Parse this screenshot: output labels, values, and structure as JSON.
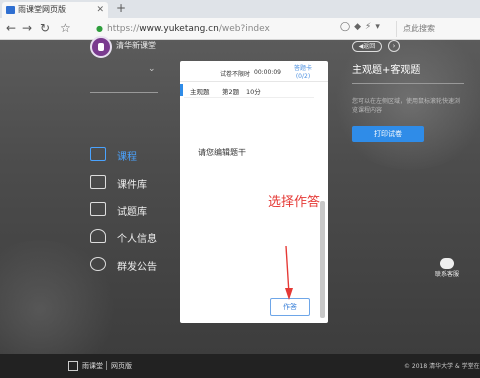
{
  "browser": {
    "tab_title": "雨课堂网页版",
    "new_tab": "+",
    "url_prefix": "https://",
    "url_host": "www.yuketang.cn",
    "url_path": "/web?index",
    "search_placeholder": "点此搜索"
  },
  "nav": {
    "brand": "清华新课堂",
    "items": [
      {
        "label": "课程",
        "icon": "course-icon",
        "active": true
      },
      {
        "label": "课件库",
        "icon": "courseware-icon",
        "active": false
      },
      {
        "label": "试题库",
        "icon": "question-bank-icon",
        "active": false
      },
      {
        "label": "个人信息",
        "icon": "profile-icon",
        "active": false
      },
      {
        "label": "群发公告",
        "icon": "announcement-icon",
        "active": false
      }
    ]
  },
  "card": {
    "timer_label": "试卷不限时",
    "timer_value": "00:00:09",
    "answer_card_label": "答题卡",
    "answer_card_count": "(0/2)",
    "question_type": "主观题",
    "question_index": "第2题",
    "question_score": "10分",
    "question_text": "请您编辑题干",
    "submit_label": "作答"
  },
  "annotation": {
    "text": "选择作答",
    "color": "#e53935"
  },
  "right_panel": {
    "back_label": "返回",
    "title": "主观题+客观题",
    "description": "您可以在左侧区域，使用鼠标滚轮快速浏览课程内容",
    "print_label": "打印试卷"
  },
  "wechat": {
    "label": "联系客服"
  },
  "footer": {
    "brand": "雨课堂",
    "sub": "网页版",
    "copyright": "© 2018 清华大学 & 学堂在线"
  },
  "colors": {
    "accent": "#2f8ce8",
    "nav_active": "#4aa3ff"
  }
}
